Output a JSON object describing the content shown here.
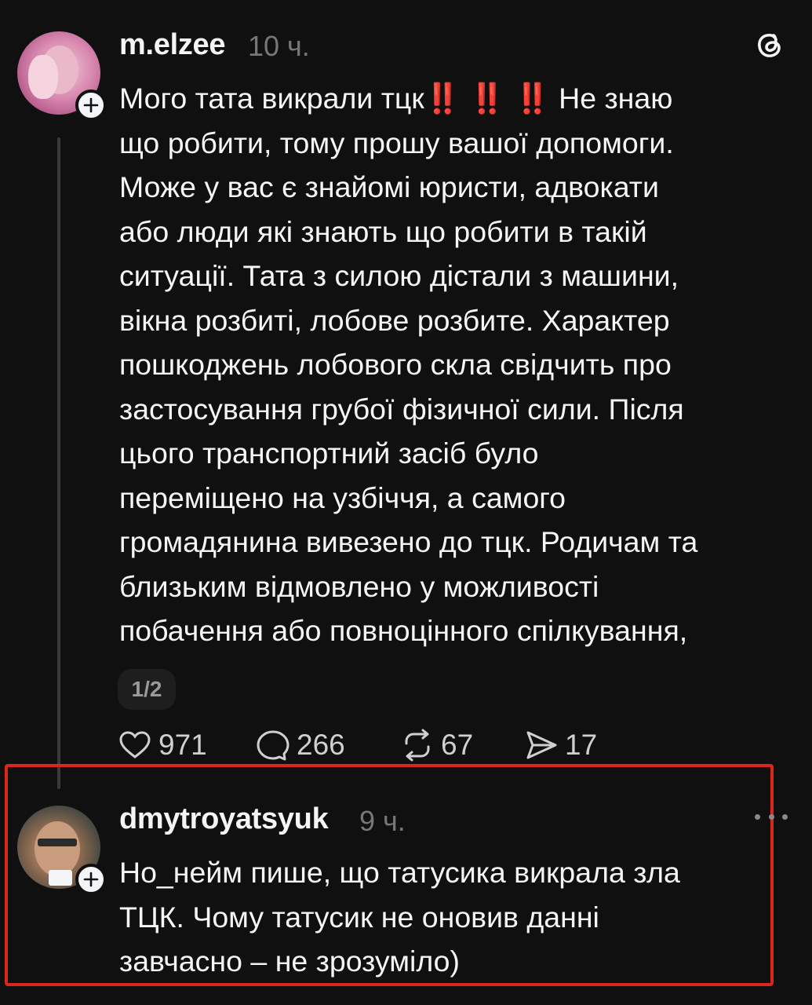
{
  "post": {
    "username": "m.elzee",
    "time": "10 ч.",
    "lines": [
      "Мого тата викрали тцк",
      "що робити, тому прошу вашої допомоги.",
      "Може у вас є знайомі юристи, адвокати",
      "або люди які знають що робити в такій",
      "ситуації. Тата з силою дістали з машини,",
      "вікна розбиті, лобове розбите. Характер",
      "пошкоджень лобового скла свідчить про",
      "застосування грубої фізичної сили. Після",
      "цього транспортний засіб було",
      "переміщено на узбіччя, а самого",
      "громадянина вивезено до тцк. Родичам та",
      "близьким відмовлено у можливості",
      "побачення або повноцінного спілкування,"
    ],
    "emphasis": "‼️ ‼️ ‼️",
    "line1_tail": "Не знаю",
    "pager": "1/2",
    "likes": "971",
    "comments": "266",
    "reposts": "67",
    "shares": "17"
  },
  "reply": {
    "username": "dmytroyatsyuk",
    "time": "9 ч.",
    "lines": [
      "Но_нейм пише, що татусика викрала зла",
      "ТЦК. Чому татусик не оновив данні",
      "завчасно – не зрозуміло)"
    ]
  },
  "colors": {
    "background": "#101010",
    "text": "#f3f5f7",
    "muted": "#777777",
    "highlight_border": "#d9271c",
    "emoji_red": "#e0251c"
  },
  "icons": [
    "threads-logo-icon",
    "heart-icon",
    "comment-icon",
    "repost-icon",
    "share-icon",
    "more-icon",
    "plus-icon"
  ]
}
